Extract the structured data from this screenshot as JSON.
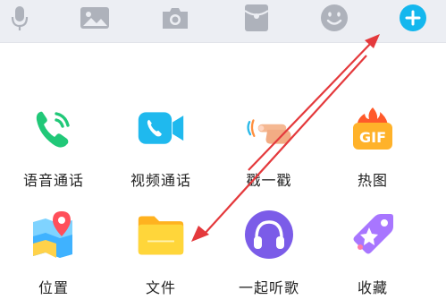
{
  "toolbar": {
    "icons": [
      "microphone-icon",
      "image-icon",
      "camera-icon",
      "red-envelope-icon",
      "emoji-icon",
      "plus-icon"
    ]
  },
  "grid": {
    "voice_call": "语音通话",
    "video_call": "视频通话",
    "poke": "戳一戳",
    "gif": "热图",
    "gif_badge": "GIF",
    "location": "位置",
    "file": "文件",
    "listen_together": "一起听歌",
    "favorites": "收藏"
  },
  "colors": {
    "toolbar_bg": "#eceef3",
    "icon_gray": "#aeb2bb",
    "accent_blue": "#14b7ee",
    "annotation_red": "#e4393c"
  }
}
